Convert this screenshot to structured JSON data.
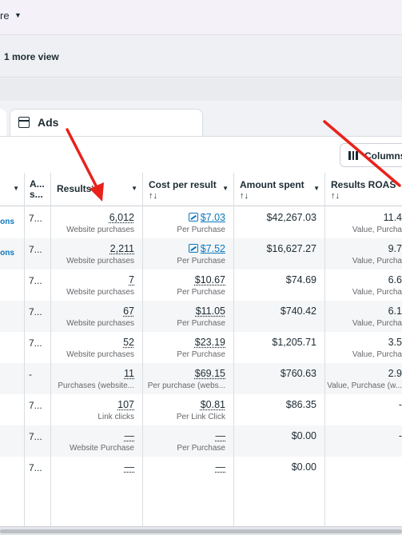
{
  "topbar": {
    "more_label": "re"
  },
  "viewbar": {
    "views_label": "1 more view"
  },
  "tabs": {
    "ads_label": "Ads"
  },
  "toolbar": {
    "columns_label": "Columns"
  },
  "table": {
    "headers": {
      "delivery_short": "A... s...",
      "results": "Results",
      "results_sort": "↑↓",
      "cost": "Cost per result",
      "cost_sort": "↑↓",
      "amount": "Amount spent",
      "amount_sort": "↑↓",
      "roas": "Results ROAS",
      "roas_sort": "↑↓"
    },
    "rows": [
      {
        "action": "tions",
        "delivery": "7...",
        "results": "6,012",
        "results_sub": "Website purchases",
        "cost": "$7.03",
        "cost_sub": "Per Purchase",
        "amount": "$42,267.03",
        "roas": "11.4",
        "roas_sub": "Value, Purcha"
      },
      {
        "action": "tions",
        "delivery": "7...",
        "results": "2,211",
        "results_sub": "Website purchases",
        "cost": "$7.52",
        "cost_sub": "Per Purchase",
        "amount": "$16,627.27",
        "roas": "9.7",
        "roas_sub": "Value, Purcha"
      },
      {
        "action": "",
        "delivery": "7...",
        "results": "7",
        "results_sub": "Website purchases",
        "cost": "$10.67",
        "cost_sub": "Per Purchase",
        "amount": "$74.69",
        "roas": "6.6",
        "roas_sub": "Value, Purcha"
      },
      {
        "action": "",
        "delivery": "7...",
        "results": "67",
        "results_sub": "Website purchases",
        "cost": "$11.05",
        "cost_sub": "Per Purchase",
        "amount": "$740.42",
        "roas": "6.1",
        "roas_sub": "Value, Purcha"
      },
      {
        "action": "",
        "delivery": "7...",
        "results": "52",
        "results_sub": "Website purchases",
        "cost": "$23.19",
        "cost_sub": "Per Purchase",
        "amount": "$1,205.71",
        "roas": "3.5",
        "roas_sub": "Value, Purcha"
      },
      {
        "action": "",
        "delivery": "-",
        "results": "11",
        "results_sub": "Purchases (website...",
        "cost": "$69.15",
        "cost_sub": "Per purchase (webs...",
        "amount": "$760.63",
        "roas": "2.9",
        "roas_sub": "Value, Purchase (w..."
      },
      {
        "action": "",
        "delivery": "7...",
        "results": "107",
        "results_sub": "Link clicks",
        "cost": "$0.81",
        "cost_sub": "Per Link Click",
        "amount": "$86.35",
        "roas": "-",
        "roas_sub": ""
      },
      {
        "action": "",
        "delivery": "7...",
        "results": "—",
        "results_sub": "Website Purchase",
        "cost": "—",
        "cost_sub": "Per Purchase",
        "amount": "$0.00",
        "roas": "-",
        "roas_sub": ""
      },
      {
        "action": "",
        "delivery": "7...",
        "results": "—",
        "results_sub": "",
        "cost": "—",
        "cost_sub": "",
        "amount": "$0.00",
        "roas": "",
        "roas_sub": ""
      }
    ]
  },
  "colors": {
    "accent": "#0a78be",
    "annotation_arrow": "#e8221b"
  }
}
